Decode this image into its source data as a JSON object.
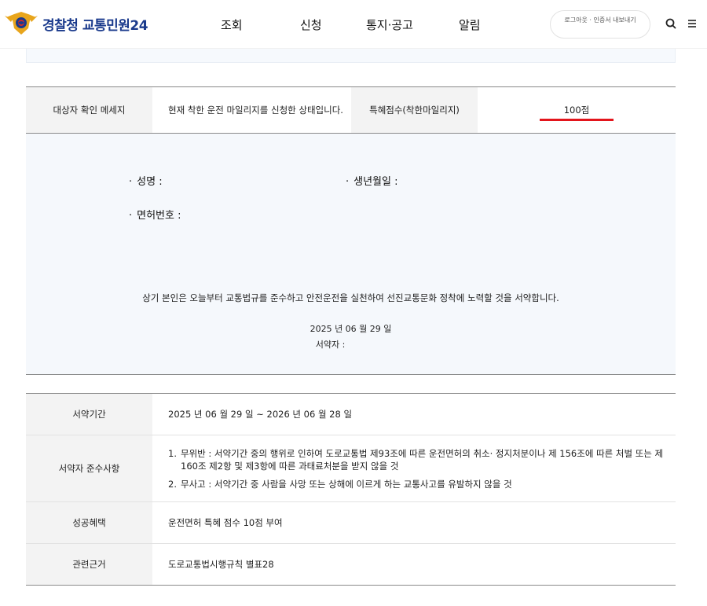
{
  "header": {
    "logo_text": "경찰청 교통민원24",
    "nav": [
      {
        "label": "조회"
      },
      {
        "label": "신청"
      },
      {
        "label": "통지·공고"
      },
      {
        "label": "알림"
      }
    ],
    "auth_button_label": "로그아웃 · 인증서 내보내기",
    "icons": [
      "search-icon",
      "menu-icon"
    ]
  },
  "info": {
    "status_label": "대상자 확인 메세지",
    "status_message": "현재 착한 운전 마일리지를 신청한 상태입니다.",
    "points_label": "특혜점수(착한마일리지)",
    "points_value": "100점"
  },
  "pledge": {
    "name_label": "성명 :",
    "birth_label": "생년월일 :",
    "license_label": "면허번호 :",
    "statement": "상기 본인은 오늘부터 교통법규를 준수하고 안전운전을 실천하여 선진교통문화 정착에 노력할 것을 서약합니다.",
    "date": "2025 년 06 월 29 일",
    "signer_label": "서약자 :"
  },
  "details": {
    "period_label": "서약기간",
    "period_value": "2025 년 06 월 29 일 ~ 2026 년 06 월 28 일",
    "rules_label": "서약자 준수사항",
    "rules": [
      {
        "num": "1.",
        "text": "무위반 : 서약기간 중의 행위로 인하여 도로교통법 제93조에 따른 운전면허의 취소· 정지처분이나 제 156조에 따른 처벌 또는 제 160조 제2항 및 제3항에 따른 과태료처분을 받지 않을 것"
      },
      {
        "num": "2.",
        "text": "무사고 : 서약기간 중 사람을 사망 또는 상해에 이르게 하는 교통사고를 유발하지 않을 것"
      }
    ],
    "benefit_label": "성공혜택",
    "benefit_value": "운전면허 특혜 점수 10점 부여",
    "basis_label": "관련근거",
    "basis_value": "도로교통법시행규칙 별표28"
  },
  "colors": {
    "brand": "#1a3a8c",
    "accent_red": "#e3151c",
    "header_cell_bg": "#f3f3f3",
    "pledge_bg": "#f5f8fc"
  }
}
